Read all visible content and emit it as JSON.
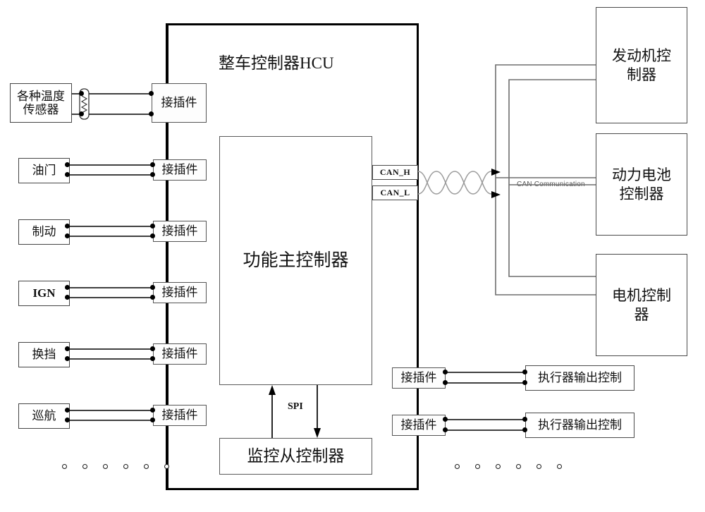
{
  "diagram": {
    "title": "整车控制器HCU",
    "spi_label": "SPI",
    "can_comm_label": "CAN Communication"
  },
  "sensors": [
    {
      "label": "各种温度传感器",
      "line1": "各种温度",
      "line2": "传感器"
    },
    {
      "label": "油门"
    },
    {
      "label": "制动"
    },
    {
      "label": "IGN"
    },
    {
      "label": "换挡"
    },
    {
      "label": "巡航"
    }
  ],
  "connectors_left": [
    {
      "label": "接插件"
    },
    {
      "label": "接插件"
    },
    {
      "label": "接插件"
    },
    {
      "label": "接插件"
    },
    {
      "label": "接插件"
    },
    {
      "label": "接插件"
    }
  ],
  "connectors_right": [
    {
      "label": "接插件"
    },
    {
      "label": "接插件"
    }
  ],
  "actuators": [
    {
      "label": "执行器输出控制"
    },
    {
      "label": "执行器输出控制"
    }
  ],
  "controllers": {
    "main": "功能主控制器",
    "slave": "监控从控制器"
  },
  "can_ports": [
    {
      "label": "CAN_H"
    },
    {
      "label": "CAN_L"
    }
  ],
  "ecus": [
    {
      "line1": "发动机控",
      "line2": "制器"
    },
    {
      "line1": "动力电池",
      "line2": "控制器"
    },
    {
      "line1": "电机控制",
      "line2": "器"
    }
  ],
  "ellipsis": {
    "left_count": 6,
    "right_count": 6
  },
  "colors": {
    "line": "#000000",
    "bus": "#000000",
    "gray_line": "#777777",
    "background": "#ffffff"
  }
}
